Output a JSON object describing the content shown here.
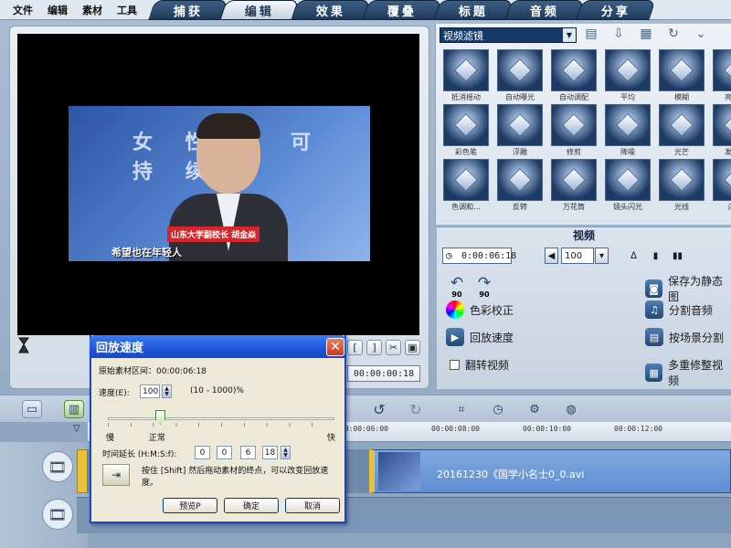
{
  "menu": [
    "文件",
    "编辑",
    "素材",
    "工具"
  ],
  "tabs": [
    "捕获",
    "编辑",
    "效果",
    "覆叠",
    "标题",
    "音频",
    "分享"
  ],
  "active_tab": "编辑",
  "preview": {
    "banner": "女  性 类 可 持 续",
    "name_tag": "山东大学副校长  胡金焱",
    "subtitle": "希望也在年轻人",
    "timecode": "00:00:00:18",
    "controls": [
      "[",
      "]",
      "scissors-icon",
      "fullscreen-icon"
    ]
  },
  "library": {
    "category": "视频滤镜",
    "filters": [
      "抵消摇动",
      "自动曝光",
      "自动调配",
      "平均",
      "模糊",
      "亮度和",
      "彩色笔",
      "浮雕",
      "修剪",
      "降噪",
      "光芒",
      "发散光",
      "色调和...",
      "反转",
      "万花筒",
      "镜头闪光",
      "光线",
      "闪电"
    ]
  },
  "options": {
    "title": "视频",
    "duration": "0:00:06:18",
    "volume": "100",
    "rotate_left": "90",
    "rotate_right": "90",
    "color_correct": "色彩校正",
    "playback_speed": "回放速度",
    "reverse_video": "翻转视频",
    "save_still": "保存为静态图",
    "split_audio": "分割音频",
    "split_by_scene": "按场景分割",
    "multi_trim": "多重修整视频"
  },
  "timeline": {
    "ticks": [
      "00:00:06:00",
      "00:00:08:00",
      "00:00:10:00",
      "00:00:12:00"
    ],
    "clip_label": "20161230《国学小名士0_0.avi"
  },
  "dialog": {
    "title": "回放速度",
    "orig_label": "原始素材区间：00:00:06:18",
    "speed_label": "速度(E):",
    "speed_value": "100",
    "speed_range": "(10 - 1000)%",
    "slow": "慢",
    "normal": "正常",
    "fast": "快",
    "extend_label": "时间延长 (H:M:S:f):",
    "time": [
      "0",
      "0",
      "6",
      "18"
    ],
    "hint": "按住 [Shift] 然后拖动素材的终点，可以改变回放速度。",
    "preview_btn": "预览P",
    "ok_btn": "确定",
    "cancel_btn": "取消"
  }
}
